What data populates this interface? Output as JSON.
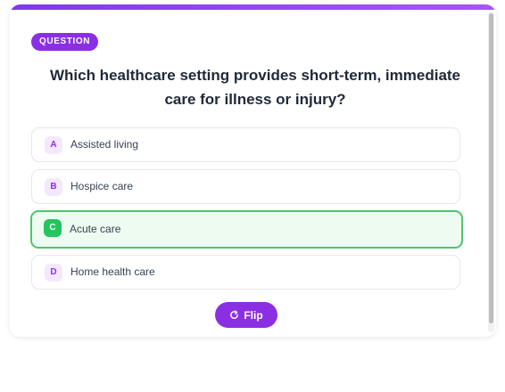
{
  "badge": {
    "label": "QUESTION"
  },
  "question": {
    "text": "Which healthcare setting provides short-term, immediate care for illness or injury?"
  },
  "options": [
    {
      "letter": "A",
      "text": "Assisted living",
      "state": "default"
    },
    {
      "letter": "B",
      "text": "Hospice care",
      "state": "default"
    },
    {
      "letter": "C",
      "text": "Acute care",
      "state": "correct"
    },
    {
      "letter": "D",
      "text": "Home health care",
      "state": "default"
    }
  ],
  "flip": {
    "label": "Flip",
    "icon": "refresh-icon"
  },
  "colors": {
    "accent": "#8b2fe3",
    "correct_border": "#4ec46f",
    "correct_bg": "#eefbf1",
    "correct_letter_bg": "#22c55e"
  }
}
